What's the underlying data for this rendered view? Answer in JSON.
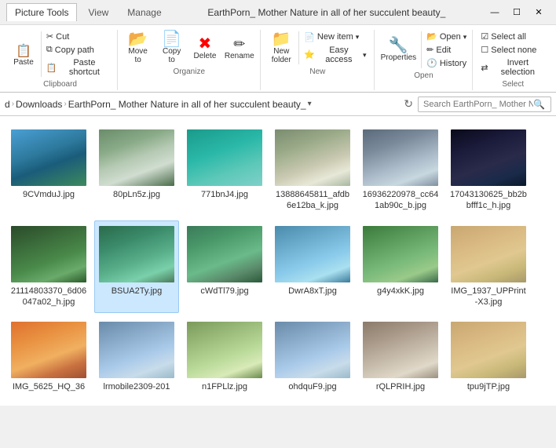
{
  "window": {
    "title": "EarthPorn_ Mother Nature in all of her succulent beauty_",
    "tab_picture_tools": "Picture Tools",
    "tab_manage": "Manage",
    "tab_view": "View",
    "btn_minimize": "—",
    "btn_maximize": "☐",
    "btn_close": "✕"
  },
  "ribbon": {
    "clipboard": {
      "label": "Clipboard",
      "paste_label": "Paste",
      "cut_label": "Cut",
      "copy_path_label": "Copy path",
      "paste_shortcut_label": "Paste shortcut"
    },
    "organize": {
      "label": "Organize",
      "move_label": "Move to",
      "copy_label": "Copy to",
      "delete_label": "Delete",
      "rename_label": "Rename"
    },
    "new": {
      "label": "New",
      "new_folder_label": "New\nfolder",
      "new_item_label": "New item",
      "easy_access_label": "Easy access"
    },
    "open": {
      "label": "Open",
      "properties_label": "Properties",
      "open_label": "Open",
      "edit_label": "Edit",
      "history_label": "History"
    },
    "select": {
      "label": "Select",
      "select_all_label": "Select all",
      "select_none_label": "Select none",
      "invert_label": "Invert selection"
    }
  },
  "address": {
    "parts": [
      "d",
      "Downloads",
      "EarthPorn_ Mother Nature in all of her succulent beauty_"
    ],
    "search_placeholder": "Search EarthPorn_ Mother Na..."
  },
  "files": [
    {
      "name": "9CVmduJ.jpg",
      "thumb": "t-ocean",
      "selected": false
    },
    {
      "name": "80pLn5z.jpg",
      "thumb": "t-waterfall",
      "selected": false
    },
    {
      "name": "771bnJ4.jpg",
      "thumb": "t-teal",
      "selected": false
    },
    {
      "name": "13888645811_afdb6e12ba_k.jpg",
      "thumb": "t-mountain",
      "selected": false
    },
    {
      "name": "16936220978_cc641ab90c_b.jpg",
      "thumb": "t-peak",
      "selected": false
    },
    {
      "name": "17043130625_bb2bbfff1c_h.jpg",
      "thumb": "t-night",
      "selected": false
    },
    {
      "name": "21114803370_6d06047a02_h.jpg",
      "thumb": "t-forest",
      "selected": false
    },
    {
      "name": "BSUA2Ty.jpg",
      "thumb": "t-river",
      "selected": true
    },
    {
      "name": "cWdTl79.jpg",
      "thumb": "t-stream",
      "selected": false
    },
    {
      "name": "DwrA8xT.jpg",
      "thumb": "t-lake",
      "selected": false
    },
    {
      "name": "g4y4xkK.jpg",
      "thumb": "t-green",
      "selected": false
    },
    {
      "name": "IMG_1937_UPPrint-X3.jpg",
      "thumb": "t-desert",
      "selected": false
    },
    {
      "name": "IMG_5625_HQ_36",
      "thumb": "t-sunset",
      "selected": false
    },
    {
      "name": "lrmobile2309-201",
      "thumb": "t-clouds",
      "selected": false
    },
    {
      "name": "n1FPLlz.jpg",
      "thumb": "t-hills",
      "selected": false
    },
    {
      "name": "ohdquF9.jpg",
      "thumb": "t-clouds",
      "selected": false
    },
    {
      "name": "rQLPRIH.jpg",
      "thumb": "t-rocks",
      "selected": false
    },
    {
      "name": "tpu9jTP.jpg",
      "thumb": "t-desert",
      "selected": false
    }
  ]
}
